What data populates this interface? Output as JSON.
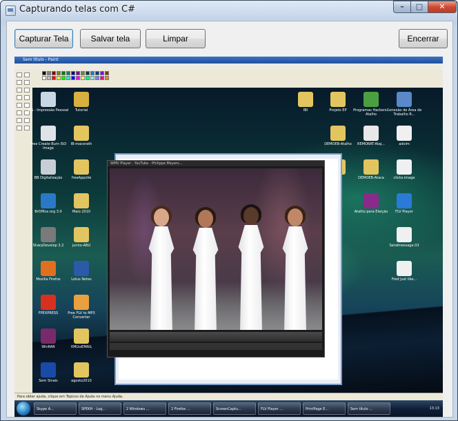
{
  "window": {
    "title": "Capturando telas com C#",
    "controls": {
      "minimize": "–",
      "maximize": "□",
      "close": "✕"
    }
  },
  "toolbar": {
    "capture_label": "Capturar Tela",
    "save_label": "Salvar tela",
    "clear_label": "Limpar",
    "exit_label": "Encerrar"
  },
  "capture": {
    "paint_title": "Sem título - Paint",
    "paint_status": "Para obter ajuda, clique em Tópicos de Ajuda no menu Ajuda.",
    "player_title": "WMV Player - YouTube - Philippe Meyers...",
    "desktop_icons": [
      {
        "label": "IPS - Impressão Pessoal",
        "color": "#c9d6e4"
      },
      {
        "label": "Tutorial",
        "color": "#d8b040"
      },
      {
        "label": "Free Create Burn ISO Image",
        "color": "#dfe3e8"
      },
      {
        "label": "IB-macorath",
        "color": "#e3c560"
      },
      {
        "label": "BB Digitalização",
        "color": "#c7ced6"
      },
      {
        "label": "freeAppsVe",
        "color": "#e3c560"
      },
      {
        "label": "BrOffice.org 3.0",
        "color": "#2a78c8"
      },
      {
        "label": "Maio 2010",
        "color": "#e3c560"
      },
      {
        "label": "SharpDevelop 3.2",
        "color": "#7a7a7a"
      },
      {
        "label": "junho-ABU",
        "color": "#e3c560"
      },
      {
        "label": "Mozilla Firefox",
        "color": "#e07020"
      },
      {
        "label": "Lotus Notes",
        "color": "#2a5aa8"
      },
      {
        "label": "FPEXPRESS",
        "color": "#d83020"
      },
      {
        "label": "Free FLV to MP3 Converter",
        "color": "#e8a040"
      },
      {
        "label": "WinRAR",
        "color": "#7a2a6a"
      },
      {
        "label": "XMLtoEMAIL",
        "color": "#e3c560"
      },
      {
        "label": "Sem Sinais",
        "color": "#1a4aa8"
      },
      {
        "label": "agosto2010",
        "color": "#e3c560"
      }
    ],
    "right_icons": [
      {
        "label": "IBI",
        "color": "#e3c560"
      },
      {
        "label": "Projeto EP",
        "color": "#e3c560"
      },
      {
        "label": "Programas Hackers - Atalho",
        "color": "#4aa040"
      },
      {
        "label": "Conexão de Área de Trabalho R...",
        "color": "#5a88c8"
      },
      {
        "label": "DEMOEB-Atalho",
        "color": "#e3c560"
      },
      {
        "label": "REMORAT-Ataj...",
        "color": "#e8e8e8"
      },
      {
        "label": "advim",
        "color": "#f0f0f0"
      },
      {
        "label": "UE",
        "color": "#e3c560"
      },
      {
        "label": "DEMOEB-Ataca",
        "color": "#e3c560"
      },
      {
        "label": "clicks.image",
        "color": "#f0f0f0"
      },
      {
        "label": "Atalho para Eleição",
        "color": "#8a2a8a"
      },
      {
        "label": "FLV Player",
        "color": "#2a7ad8"
      },
      {
        "label": "Sendmessage.03",
        "color": "#f0f0f0"
      },
      {
        "label": "Fred just like...",
        "color": "#f0f0f0"
      }
    ],
    "taskbar_items": [
      "Skype A...",
      "SPEKH - Log...",
      "2 Windows ...",
      "2 Firefox ...",
      "ScreenCaptu...",
      "FLV Player ...",
      "PrintPage E...",
      "Sem título ..."
    ],
    "clock": "13:13"
  }
}
